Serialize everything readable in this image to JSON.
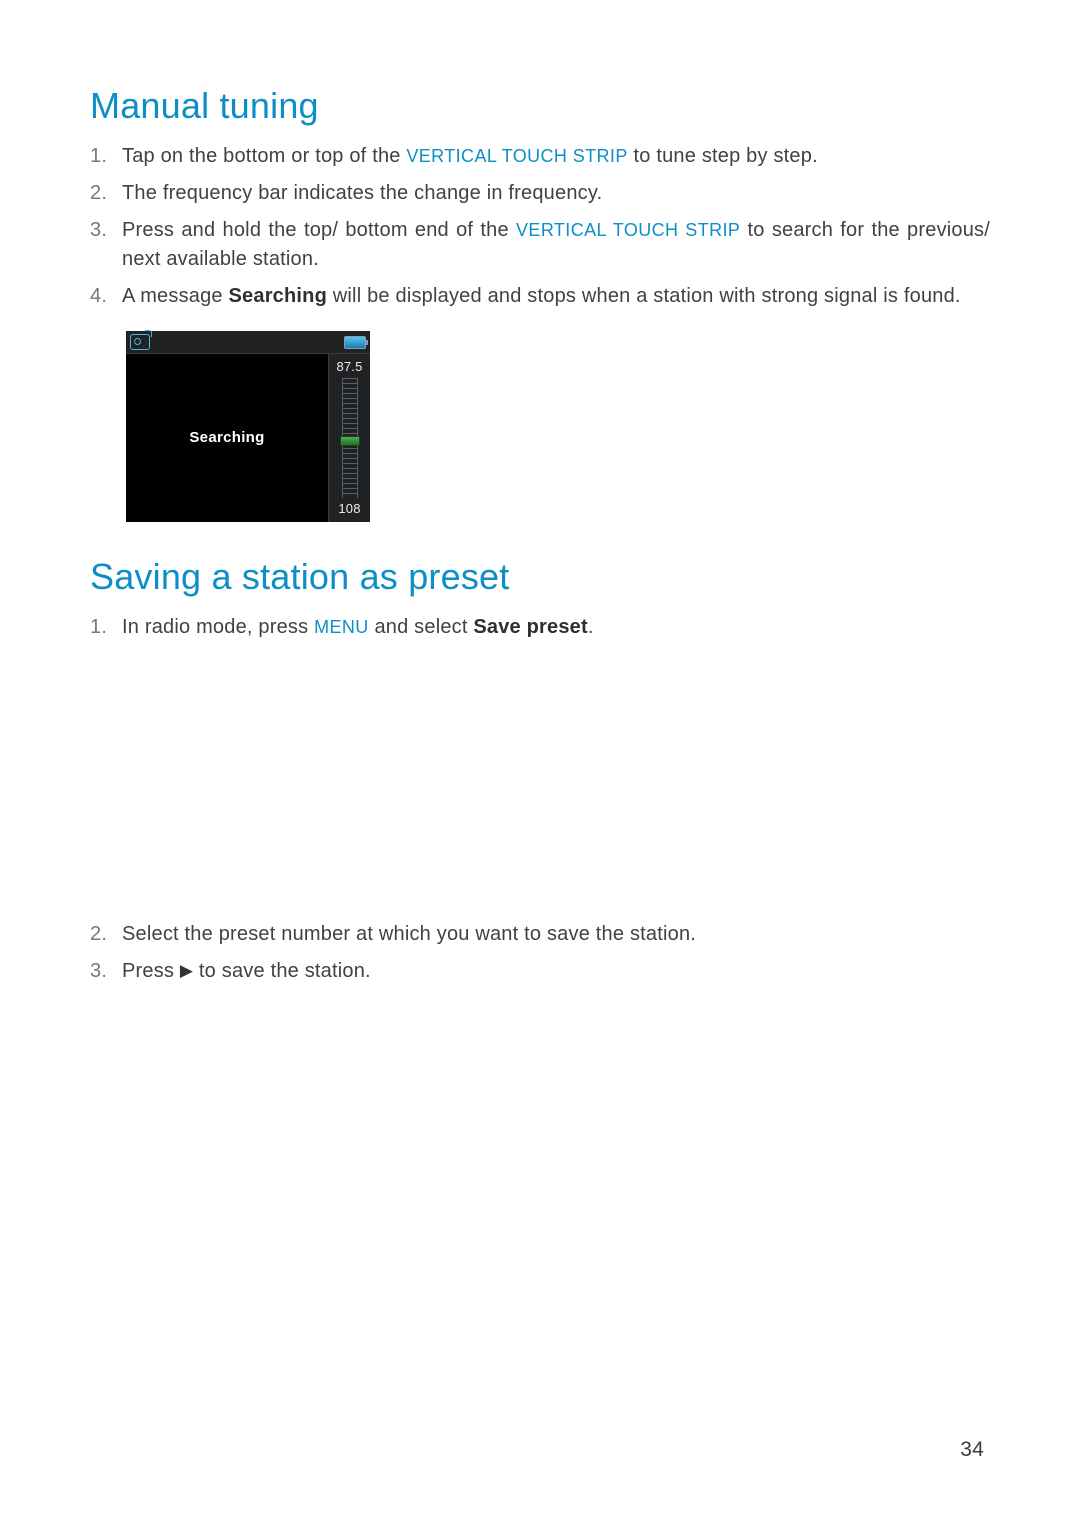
{
  "headings": {
    "manual_tuning": "Manual tuning",
    "saving_preset": "Saving a station as preset"
  },
  "keywords": {
    "vertical_touch_strip": "VERTICAL TOUCH STRIP",
    "searching": "Searching",
    "menu": "MENU",
    "save_preset": "Save preset"
  },
  "manual_steps": [
    {
      "num": "1.",
      "pre": "Tap on the bottom or top of the ",
      "kw": "VERTICAL TOUCH STRIP",
      "post": " to tune step by step."
    },
    {
      "num": "2.",
      "text": "The frequency bar indicates the change in frequency."
    },
    {
      "num": "3.",
      "pre": "Press and hold the top/ bottom end of the ",
      "kw": "VERTICAL TOUCH STRIP",
      "post": " to search for the previous/ next available station.",
      "justify": true
    },
    {
      "num": "4.",
      "pre": "A message ",
      "bold": "Searching",
      "post": " will be displayed and stops when a station with strong signal is found."
    }
  ],
  "preset_steps_a": [
    {
      "num": "1.",
      "pre": "In radio mode, press ",
      "kw": "MENU",
      "mid": " and select ",
      "bold": "Save preset",
      "post": "."
    }
  ],
  "preset_steps_b": [
    {
      "num": "2.",
      "text": "Select the preset number at which you want to save the station."
    },
    {
      "num": "3.",
      "pre": "Press ",
      "icon": "▶",
      "post": " to save the station."
    }
  ],
  "device": {
    "searching_label": "Searching",
    "freq_top": "87.5",
    "freq_bottom": "108"
  },
  "page_number": "34"
}
